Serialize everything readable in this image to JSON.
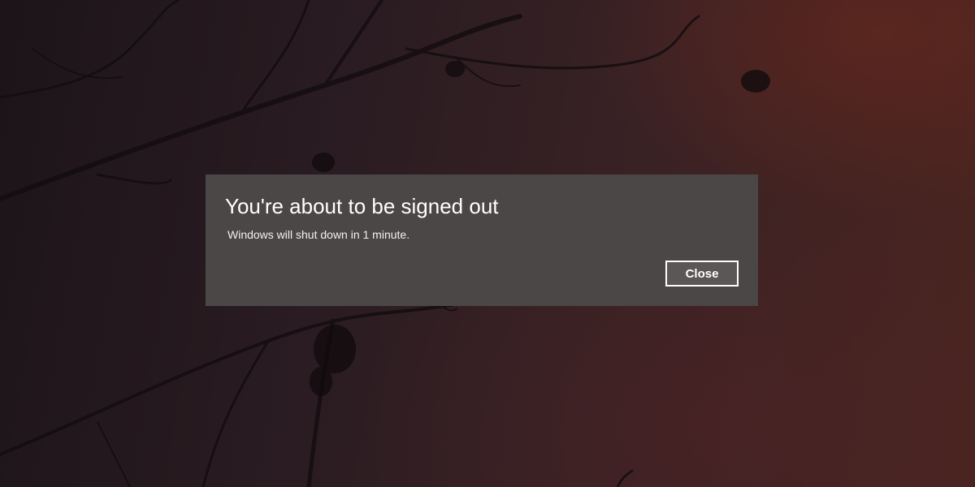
{
  "dialog": {
    "title": "You're about to be signed out",
    "message": "Windows will shut down in 1 minute.",
    "close_label": "Close"
  },
  "colors": {
    "dialog_background": "#4a4746",
    "button_border": "#ffffff",
    "text": "#ffffff"
  },
  "wallpaper": {
    "subject": "dark branches silhouetted against reddish dusk sky"
  }
}
